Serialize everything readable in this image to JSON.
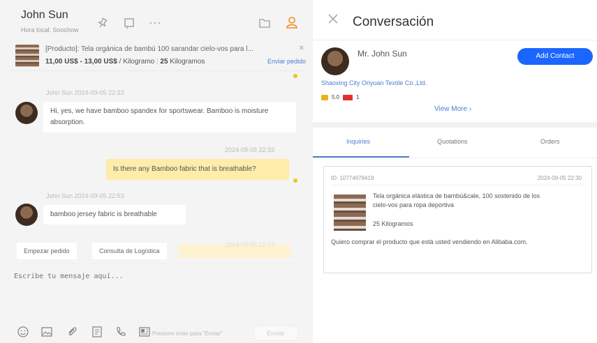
{
  "left": {
    "contact_name": "John Sun",
    "contact_subtitle": "Hora local: Soochow",
    "product": {
      "title": "[Producto]: Tela orgánica de bambú 100 sarandar cielo-vos para l...",
      "price": "11,00 US$ - 13,00 US$",
      "unit": "/ Kilogramo",
      "moq": "25",
      "moq_unit": "Kilogramos",
      "link": "Enviar pedido"
    },
    "messages": [
      {
        "meta": "John Sun  2024-09-05 22:33",
        "text": "Hi,  yes,  we have bamboo spandex for sportswear. Bamboo is moisture absorption."
      },
      {
        "meta": "2024-09-05 22:33",
        "text": "Is there any Bamboo fabric that is breathable?"
      },
      {
        "meta": "John Sun  2024-09-05 22:53",
        "text": "bamboo jersey fabric is breathable"
      }
    ],
    "quick_replies": [
      "Empezar pedido",
      "Consulta de Logística"
    ],
    "faded_timestamp": "2024-09-05 22:53",
    "compose_placeholder": "Escribe tu mensaje aquí...",
    "send_hint": "Presione enter para \"Enviar\"",
    "send_label": "Enviar"
  },
  "right": {
    "title": "Conversación",
    "contact_name": "Mr. John Sun",
    "add_contact": "Add Contact",
    "company": "Shaoxing City Oriyuan Textile Co.,Ltd.",
    "badge_gold": "5.0",
    "badge_years": "1",
    "view_more": "View More",
    "tabs": [
      "Inquiries",
      "Quotations",
      "Orders"
    ],
    "inquiry": {
      "id": "ID: 10774678419",
      "date": "2024-09-05 22:30",
      "title": "Tela orgánica elástica de bambú&cale, 100 sostenido de los cielo-vos para ropa deportiva",
      "qty": "25 Kilogramos",
      "message": "Quiero comprar el producto que está usted vendiendo en Alibaba.com."
    }
  },
  "colors": {
    "accent_blue": "#1a66ff",
    "link_blue": "#4a7dd1",
    "own_bubble": "#fdecaa",
    "user_icon_orange": "#f08c1d"
  }
}
